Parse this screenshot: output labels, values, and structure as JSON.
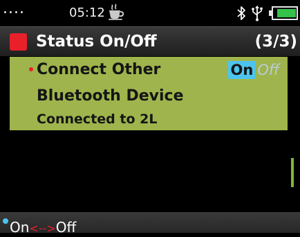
{
  "status_bar": {
    "dots": "....",
    "time": "05:12",
    "icons": {
      "cup": "coffee-cup-icon",
      "bluetooth": "bluetooth-icon",
      "usb": "usb-icon",
      "battery": "battery-icon"
    },
    "battery_level": 0.8
  },
  "header": {
    "title": "Status On/Off",
    "page": "(3/3)",
    "marker_color": "#e8202a"
  },
  "setting": {
    "label": "Connect Other",
    "sublabel": "Bluetooth Device",
    "detail": "Connected to 2L",
    "toggle": {
      "on_label": "On",
      "off_label": "Off",
      "selected": "On"
    }
  },
  "softkeys": {
    "on": "On",
    "arrow": "<-->",
    "off": "Off"
  },
  "colors": {
    "panel": "#9fb44c",
    "accent_blue": "#4cc4ee",
    "accent_red": "#e8202a",
    "background": "#000000"
  }
}
